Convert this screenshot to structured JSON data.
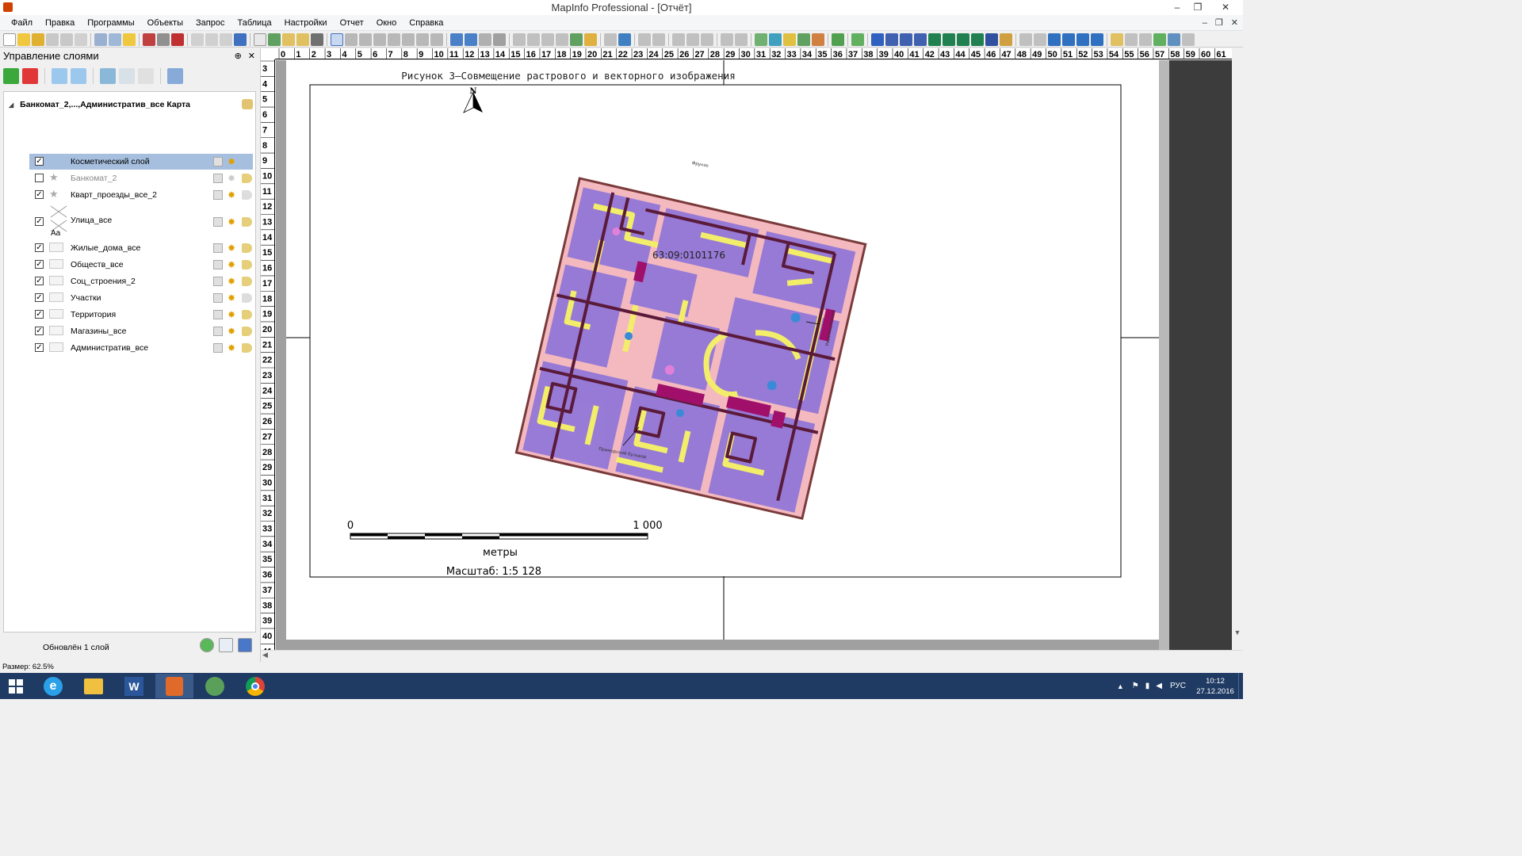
{
  "window": {
    "title": "MapInfo Professional - [Отчёт]",
    "controls": [
      "–",
      "❐",
      "✕"
    ]
  },
  "menu": {
    "items": [
      "Файл",
      "Правка",
      "Программы",
      "Объекты",
      "Запрос",
      "Таблица",
      "Настройки",
      "Отчет",
      "Окно",
      "Справка"
    ],
    "mdi_controls": [
      "–",
      "❐",
      "✕"
    ]
  },
  "layer_panel": {
    "title": "Управление слоями",
    "pin_icon": "pin-icon",
    "map_node": "Банкомат_2,...,Административ_все Карта",
    "layers": [
      {
        "name": "Косметический слой",
        "checked": true,
        "selected": true
      },
      {
        "name": "Банкомат_2",
        "checked": false,
        "dim": true
      },
      {
        "name": "Кварт_проезды_все_2",
        "checked": true
      },
      {
        "name": "Улица_все",
        "checked": true
      },
      {
        "name": "Жилые_дома_все",
        "checked": true
      },
      {
        "name": "Обществ_все",
        "checked": true
      },
      {
        "name": "Соц_строения_2",
        "checked": true
      },
      {
        "name": "Участки",
        "checked": true
      },
      {
        "name": "Территория",
        "checked": true
      },
      {
        "name": "Магазины_все",
        "checked": true
      },
      {
        "name": "Административ_все",
        "checked": true
      }
    ],
    "thumb_label_aa": "Aa",
    "status": "Обновлён 1 слой"
  },
  "report": {
    "figure_caption": "Рисунок 3–Совмещение растрового и векторного изображения",
    "north_label": "N",
    "parcel_label": "63:09:0101176",
    "street_top": "Фрунзе",
    "street_right": "Революционная",
    "street_bottom": "Приморский бульвар",
    "scale_start": "0",
    "scale_end": "1 000",
    "scale_units": "метры",
    "scale_text": "Масштаб: 1:5 128"
  },
  "rulers": {
    "h_start": 0,
    "h_end": 61,
    "v_start": 3,
    "v_end": 41
  },
  "status_bar": {
    "size": "Размер: 62.5%"
  },
  "taskbar": {
    "language": "РУС",
    "time": "10:12",
    "date": "27.12.2016"
  }
}
